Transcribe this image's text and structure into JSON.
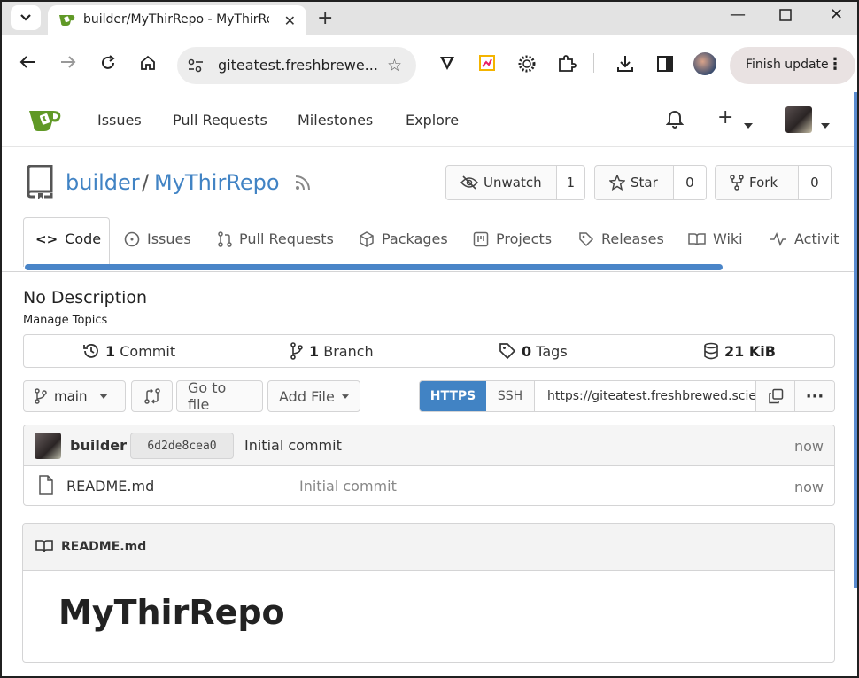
{
  "browser": {
    "tab_title": "builder/MyThirRepo - MyThirRe",
    "url": "giteatest.freshbrewe...",
    "finish_update_label": "Finish update"
  },
  "nav": {
    "issues": "Issues",
    "pull_requests": "Pull Requests",
    "milestones": "Milestones",
    "explore": "Explore"
  },
  "repo": {
    "owner": "builder",
    "separator": "/",
    "name": "MyThirRepo",
    "watch_label": "Unwatch",
    "watch_count": "1",
    "star_label": "Star",
    "star_count": "0",
    "fork_label": "Fork",
    "fork_count": "0"
  },
  "tabs": [
    {
      "label": "Code"
    },
    {
      "label": "Issues"
    },
    {
      "label": "Pull Requests"
    },
    {
      "label": "Packages"
    },
    {
      "label": "Projects"
    },
    {
      "label": "Releases"
    },
    {
      "label": "Wiki"
    },
    {
      "label": "Activit"
    }
  ],
  "description": "No Description",
  "manage_topics": "Manage Topics",
  "stats": {
    "commits_count": "1",
    "commits_label": "Commit",
    "branches_count": "1",
    "branches_label": "Branch",
    "tags_count": "0",
    "tags_label": "Tags",
    "size": "21 KiB"
  },
  "file_toolbar": {
    "branch": "main",
    "go_to_file": "Go to file",
    "add_file": "Add File",
    "https": "HTTPS",
    "ssh": "SSH",
    "clone_url": "https://giteatest.freshbrewed.scie"
  },
  "latest_commit": {
    "author": "builder",
    "sha": "6d2de8cea0",
    "message": "Initial commit",
    "time": "now"
  },
  "files": [
    {
      "name": "README.md",
      "message": "Initial commit",
      "time": "now"
    }
  ],
  "readme": {
    "filename": "README.md",
    "heading": "MyThirRepo"
  },
  "colors": {
    "link": "#4183c4",
    "https_active": "#4183c4",
    "gitea_green": "#609926"
  }
}
